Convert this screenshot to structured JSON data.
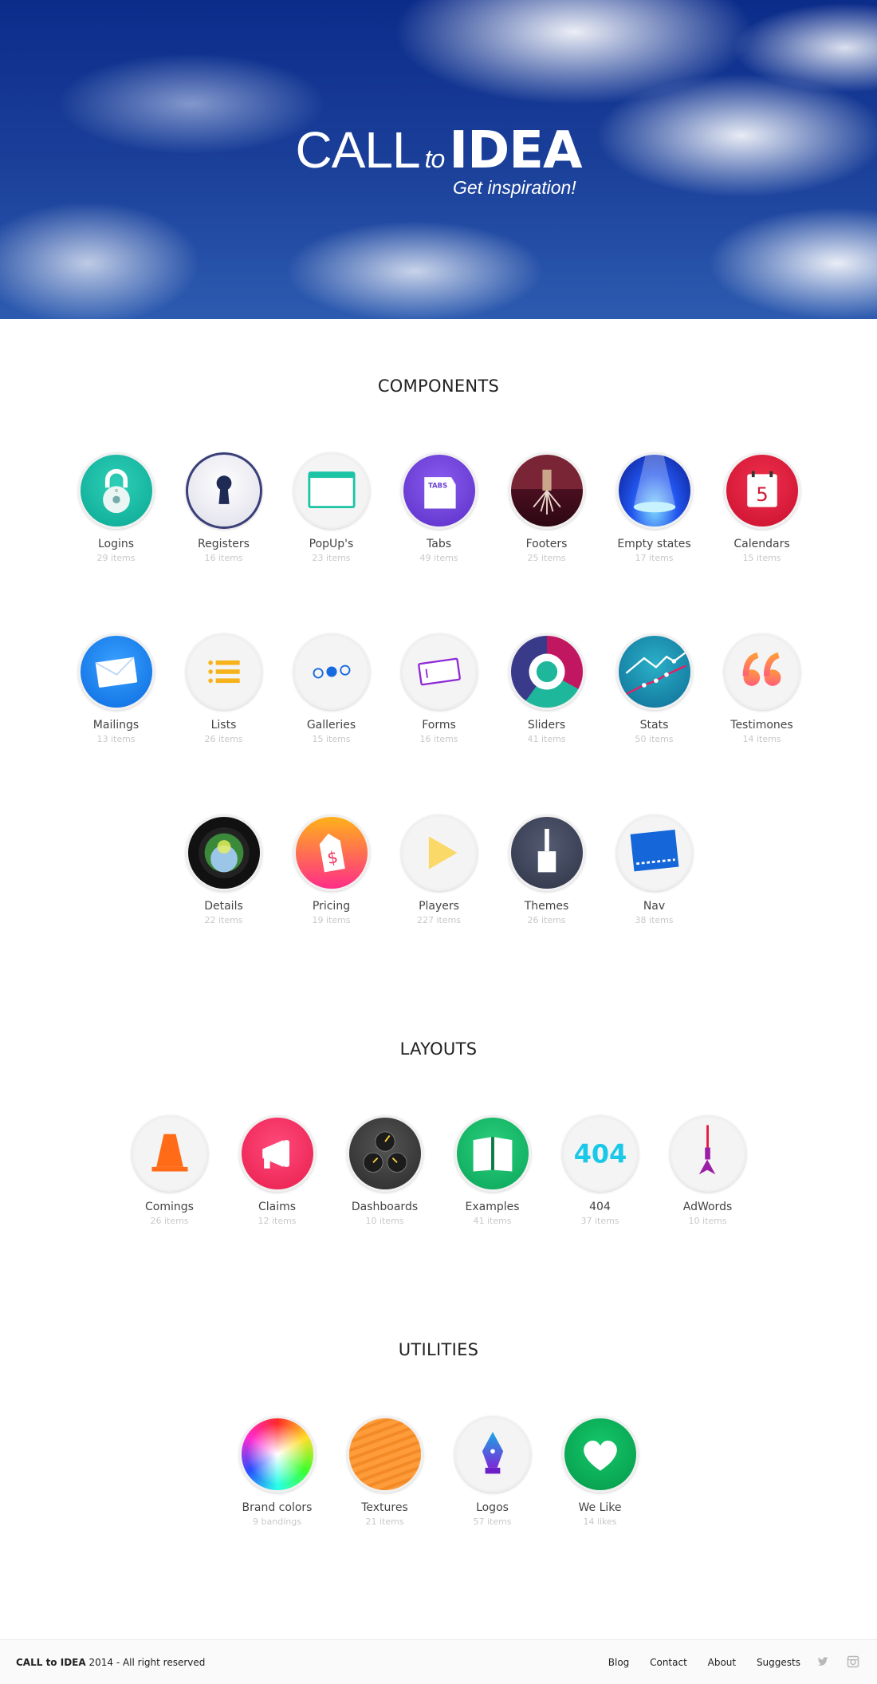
{
  "hero": {
    "title_light": "CALL",
    "title_to": "to",
    "title_bold": "IDEA",
    "subtitle": "Get inspiration!"
  },
  "components": {
    "heading": "COMPONENTS",
    "items": [
      {
        "name": "Logins",
        "count": "29 items",
        "icon": "padlock-icon"
      },
      {
        "name": "Registers",
        "count": "16 items",
        "icon": "keyhole-icon"
      },
      {
        "name": "PopUp's",
        "count": "23 items",
        "icon": "popup-window-icon"
      },
      {
        "name": "Tabs",
        "count": "49 items",
        "icon": "tabs-icon"
      },
      {
        "name": "Footers",
        "count": "25 items",
        "icon": "tree-roots-icon"
      },
      {
        "name": "Empty states",
        "count": "17 items",
        "icon": "spotlight-icon"
      },
      {
        "name": "Calendars",
        "count": "15 items",
        "icon": "calendar-icon"
      },
      {
        "name": "Mailings",
        "count": "13 items",
        "icon": "envelope-icon"
      },
      {
        "name": "Lists",
        "count": "26 items",
        "icon": "list-icon"
      },
      {
        "name": "Galleries",
        "count": "15 items",
        "icon": "gallery-dots-icon"
      },
      {
        "name": "Forms",
        "count": "16 items",
        "icon": "form-field-icon"
      },
      {
        "name": "Sliders",
        "count": "41 items",
        "icon": "slider-ring-icon"
      },
      {
        "name": "Stats",
        "count": "50 items",
        "icon": "line-chart-icon"
      },
      {
        "name": "Testimones",
        "count": "14 items",
        "icon": "quote-icon"
      },
      {
        "name": "Details",
        "count": "22 items",
        "icon": "camera-lens-icon"
      },
      {
        "name": "Pricing",
        "count": "19 items",
        "icon": "price-tag-icon"
      },
      {
        "name": "Players",
        "count": "227 items",
        "icon": "play-icon"
      },
      {
        "name": "Themes",
        "count": "26 items",
        "icon": "paintbrush-icon"
      },
      {
        "name": "Nav",
        "count": "38 items",
        "icon": "nav-bar-icon"
      }
    ]
  },
  "layouts": {
    "heading": "LAYOUTS",
    "items": [
      {
        "name": "Comings",
        "count": "26 items",
        "icon": "traffic-cone-icon"
      },
      {
        "name": "Claims",
        "count": "12 items",
        "icon": "megaphone-icon"
      },
      {
        "name": "Dashboards",
        "count": "10 items",
        "icon": "gauges-icon"
      },
      {
        "name": "Examples",
        "count": "41 items",
        "icon": "open-book-icon"
      },
      {
        "name": "404",
        "count": "37 items",
        "icon": "404-icon"
      },
      {
        "name": "AdWords",
        "count": "10 items",
        "icon": "dart-icon"
      }
    ]
  },
  "utilities": {
    "heading": "UTILITIES",
    "items": [
      {
        "name": "Brand colors",
        "count": "9 bandings",
        "icon": "color-wheel-icon"
      },
      {
        "name": "Textures",
        "count": "21 items",
        "icon": "wood-texture-icon"
      },
      {
        "name": "Logos",
        "count": "57 items",
        "icon": "pen-nib-icon"
      },
      {
        "name": "We Like",
        "count": "14 likes",
        "icon": "heart-icon"
      }
    ]
  },
  "footer": {
    "brand": "CALL to IDEA",
    "copyright": "2014 - All right reserved",
    "links": [
      "Blog",
      "Contact",
      "About",
      "Suggests"
    ],
    "social": [
      "twitter-icon",
      "instagram-icon"
    ]
  }
}
